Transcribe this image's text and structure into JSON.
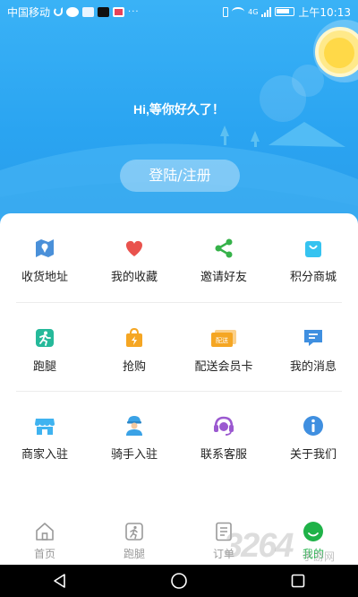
{
  "status_bar": {
    "carrier": "中国移动",
    "dots": "···",
    "network_badge": "4G",
    "time": "上午10:13"
  },
  "header": {
    "greeting": "Hi,等你好久了！",
    "login_button": "登陆/注册"
  },
  "menu_rows": [
    [
      {
        "label": "收货地址",
        "icon": "map-icon",
        "color": "#4a90d9"
      },
      {
        "label": "我的收藏",
        "icon": "heart-icon",
        "color": "#e9524d"
      },
      {
        "label": "邀请好友",
        "icon": "share-icon",
        "color": "#36b24a"
      },
      {
        "label": "积分商城",
        "icon": "shopping-bag-icon",
        "color": "#35c3f0"
      }
    ],
    [
      {
        "label": "跑腿",
        "icon": "runner-icon",
        "color": "#25b99a"
      },
      {
        "label": "抢购",
        "icon": "flash-bag-icon",
        "color": "#f5a623"
      },
      {
        "label": "配送会员卡",
        "icon": "member-card-icon",
        "color": "#f5a623",
        "badge": "配送"
      },
      {
        "label": "我的消息",
        "icon": "message-icon",
        "color": "#3f8fe0"
      }
    ],
    [
      {
        "label": "商家入驻",
        "icon": "store-icon",
        "color": "#3fb3f0"
      },
      {
        "label": "骑手入驻",
        "icon": "rider-icon",
        "color": "#3aa2e6"
      },
      {
        "label": "联系客服",
        "icon": "customer-service-icon",
        "color": "#9b59d0"
      },
      {
        "label": "关于我们",
        "icon": "info-icon",
        "color": "#3f8fe0"
      }
    ]
  ],
  "bottom_nav": [
    {
      "label": "首页",
      "icon": "home-icon",
      "active": false
    },
    {
      "label": "跑腿",
      "icon": "runner-icon",
      "active": false
    },
    {
      "label": "订单",
      "icon": "order-list-icon",
      "active": false
    },
    {
      "label": "我的",
      "icon": "profile-icon",
      "active": true
    }
  ],
  "colors": {
    "header_top": "#3ab2f6",
    "header_bottom": "#2a9be9",
    "active_green": "#1fb248",
    "inactive_gray": "#999999"
  },
  "watermark": {
    "mark": "3264",
    "site": "手游网"
  }
}
